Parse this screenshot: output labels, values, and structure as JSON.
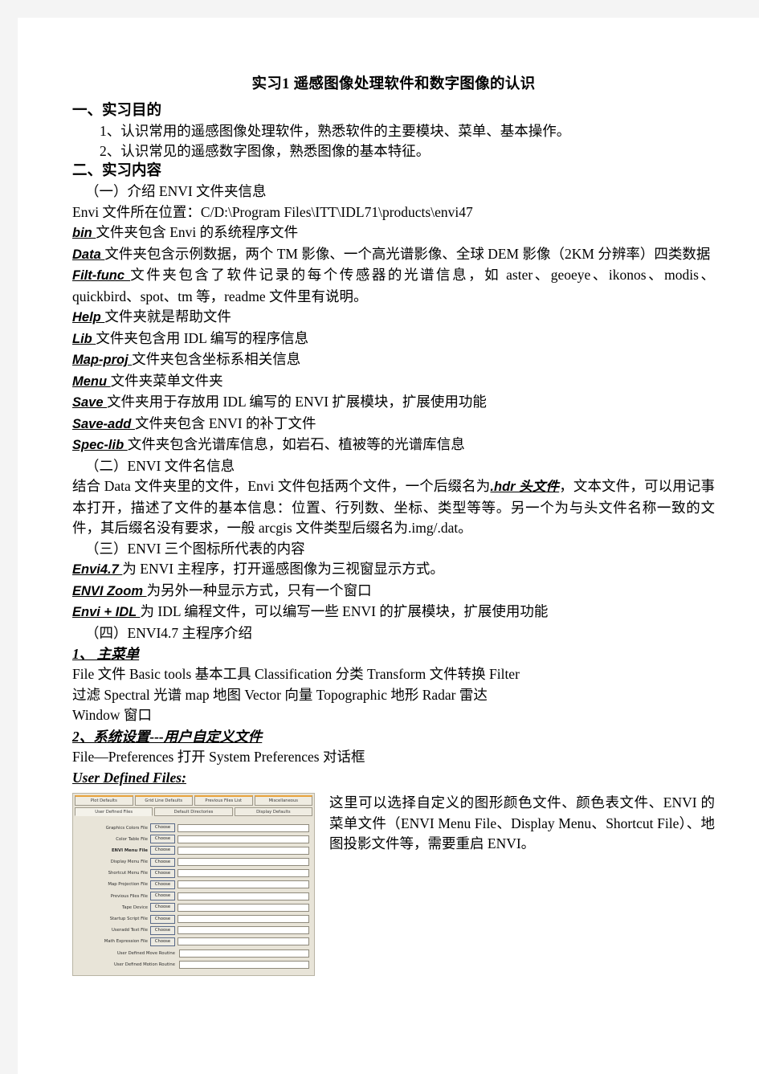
{
  "document": {
    "title": "实习1  遥感图像处理软件和数字图像的认识",
    "sections": {
      "purpose_heading": "一、实习目的",
      "purpose_items": [
        "1、认识常用的遥感图像处理软件，熟悉软件的主要模块、菜单、基本操作。",
        "2、认识常见的遥感数字图像，熟悉图像的基本特征。"
      ],
      "content_heading": "二、实习内容",
      "part1_heading": "（一）介绍 ENVI 文件夹信息",
      "envi_path_line": "Envi 文件所在位置：C/D:\\Program Files\\ITT\\IDL71\\products\\envi47",
      "folders": [
        {
          "name": "bin ",
          "desc": "文件夹包含 Envi 的系统程序文件"
        },
        {
          "name": "Data ",
          "desc": "文件夹包含示例数据，两个 TM 影像、一个高光谱影像、全球 DEM 影像（2KM 分辨率）四类数据"
        },
        {
          "name": "Filt-func ",
          "desc": "文件夹包含了软件记录的每个传感器的光谱信息，如 aster、geoeye、ikonos、modis、quickbird、spot、tm 等，readme 文件里有说明。"
        },
        {
          "name": "Help ",
          "desc": "文件夹就是帮助文件"
        },
        {
          "name": "Lib ",
          "desc": "文件夹包含用 IDL 编写的程序信息"
        },
        {
          "name": "Map-proj ",
          "desc": "文件夹包含坐标系相关信息"
        },
        {
          "name": "Menu ",
          "desc": "文件夹菜单文件夹"
        },
        {
          "name": "Save ",
          "desc": "文件夹用于存放用 IDL 编写的 ENVI 扩展模块，扩展使用功能"
        },
        {
          "name": "Save-add ",
          "desc": "文件夹包含 ENVI 的补丁文件"
        },
        {
          "name": "Spec-lib ",
          "desc": "文件夹包含光谱库信息，如岩石、植被等的光谱库信息"
        }
      ],
      "part2_heading": "（二）ENVI 文件名信息",
      "part2_text_a": "结合 Data 文件夹里的文件，Envi 文件包括两个文件，一个后缀名为",
      "part2_emph": ".hdr 头文件",
      "part2_text_b": "，文本文件，可以用记事本打开，描述了文件的基本信息：位置、行列数、坐标、类型等等。另一个为与头文件名称一致的文件，其后缀名没有要求，一般 arcgis 文件类型后缀名为.img/.dat。",
      "part3_heading": "（三）ENVI 三个图标所代表的内容",
      "icons": [
        {
          "name": "Envi4.7 ",
          "desc": "为 ENVI 主程序，打开遥感图像为三视窗显示方式。"
        },
        {
          "name": "ENVI Zoom ",
          "desc": "为另外一种显示方式，只有一个窗口"
        },
        {
          "name": "Envi + IDL ",
          "desc": "为 IDL 编程文件，可以编写一些 ENVI 的扩展模块，扩展使用功能"
        }
      ],
      "part4_heading": "（四）ENVI4.7 主程序介绍",
      "menu_heading": "1、 主菜单",
      "menu_line1": "File 文件  Basic tools 基本工具 Classification  分类 Transform  文件转换  Filter",
      "menu_line2": "过滤 Spectral  光谱  map 地图  Vector  向量  Topographic  地形  Radar  雷达",
      "menu_line3": "Window  窗口",
      "settings_heading": "2、系统设置---用户自定义文件",
      "settings_line": "File—Preferences  打开 System Preferences 对话框",
      "user_defined_files_label": "User Defined Files: ",
      "note_text": "这里可以选择自定义的图形颜色文件、颜色表文件、ENVI 的菜单文件（ENVI Menu File、Display Menu、Shortcut File）、地图投影文件等，需要重启 ENVI。"
    }
  },
  "figure": {
    "tabs_row1": [
      "Plot Defaults",
      "Grid Line Defaults",
      "Previous Files List",
      "Miscellaneous"
    ],
    "tabs_row2": [
      "User Defined Files",
      "Default Directories",
      "Display Defaults"
    ],
    "choose_label": "Choose",
    "fields": [
      {
        "label": "Graphics Colors File",
        "bold": false,
        "value": ""
      },
      {
        "label": "Color Table File",
        "bold": false,
        "value": ""
      },
      {
        "label": "ENVI Menu File",
        "bold": true,
        "value": ""
      },
      {
        "label": "Display Menu File",
        "bold": false,
        "value": ""
      },
      {
        "label": "Shortcut Menu File",
        "bold": false,
        "value": ""
      },
      {
        "label": "Map Projection File",
        "bold": false,
        "value": ""
      },
      {
        "label": "Previous Files File",
        "bold": false,
        "value": ""
      },
      {
        "label": "Tape Device",
        "bold": false,
        "value": ""
      },
      {
        "label": "Startup Script File",
        "bold": false,
        "value": ""
      },
      {
        "label": "Useradd Text File",
        "bold": false,
        "value": ""
      },
      {
        "label": "Math Expression File",
        "bold": false,
        "value": ""
      }
    ],
    "routine_fields": [
      {
        "label": "User Defined Move Routine",
        "value": ""
      },
      {
        "label": "User Defined Motion Routine",
        "value": ""
      }
    ]
  }
}
